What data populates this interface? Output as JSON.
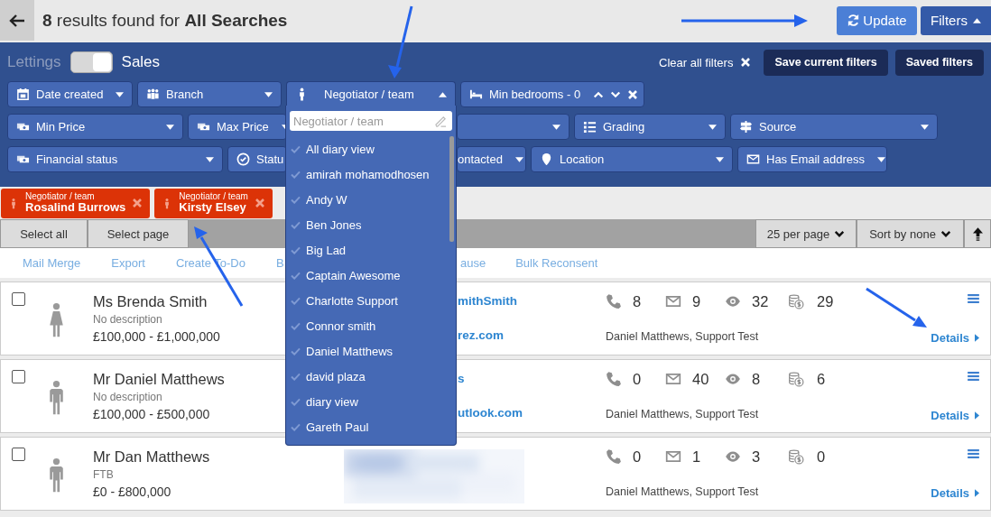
{
  "header": {
    "title": "**8** results found for **All Searches**",
    "update": {
      "label": "Update"
    },
    "filters": {
      "label": "Filters",
      "expanded": true
    }
  },
  "filter_panel": {
    "toggle": {
      "left_label": "Lettings",
      "right_label": "Sales",
      "on": true
    },
    "clear_label": "Clear all filters",
    "buttons": [
      "Save current filters",
      "Saved filters"
    ],
    "rows": [
      [
        {
          "kind": "select",
          "label": "Date created",
          "expanded": false
        },
        {
          "kind": "select",
          "label": "Branch",
          "expanded": false
        },
        {
          "kind": "select",
          "label": "Negotiator / team",
          "expanded": true
        },
        {
          "kind": "stepper",
          "label": "Min bedrooms - 0"
        }
      ],
      [
        {
          "kind": "select",
          "label": "Min Price",
          "expanded": false
        },
        {
          "kind": "select",
          "label": "Max Price",
          "expanded": false
        },
        {
          "kind": "fragment"
        },
        {
          "kind": "select",
          "label": "Grading",
          "expanded": false
        },
        {
          "kind": "select",
          "label": "Source",
          "expanded": false
        }
      ],
      [
        {
          "kind": "select",
          "label": "Financial status",
          "expanded": false
        },
        {
          "kind": "select",
          "label": "Statu",
          "expanded": false
        },
        {
          "kind": "fragment",
          "label": "ontacted"
        },
        {
          "kind": "select",
          "label": "Location",
          "expanded": false
        },
        {
          "kind": "select",
          "label": "Has Email address",
          "expanded": false
        }
      ]
    ]
  },
  "dropdown": {
    "placeholder": "Negotiator / team",
    "options": [
      {
        "label": "All diary view",
        "selected": false
      },
      {
        "label": "amirah mohamodhosen",
        "selected": false
      },
      {
        "label": "Andy W",
        "selected": false
      },
      {
        "label": "Ben Jones",
        "selected": false
      },
      {
        "label": "Big Lad",
        "selected": false
      },
      {
        "label": "Captain Awesome",
        "selected": false
      },
      {
        "label": "Charlotte Support",
        "selected": false
      },
      {
        "label": "Connor smith",
        "selected": false
      },
      {
        "label": "Daniel Matthews",
        "selected": false
      },
      {
        "label": "david plaza",
        "selected": false
      },
      {
        "label": "diary view",
        "selected": false
      },
      {
        "label": "Gareth Paul",
        "selected": false
      }
    ]
  },
  "active_filters": [
    {
      "caption": "Negotiator / team",
      "value": "Rosalind Burrows"
    },
    {
      "caption": "Negotiator / team",
      "value": "Kirsty Elsey"
    }
  ],
  "toolbar": {
    "select_buttons": [
      "Select all",
      "Select page"
    ],
    "per_page": "25 per page",
    "sort": "Sort by none"
  },
  "actions": {
    "left": [
      "Mail Merge",
      "Export",
      "Create To-Do",
      "B"
    ],
    "right": [
      "ause",
      "Bulk Reconsent"
    ]
  },
  "results": [
    {
      "name": "Ms Brenda Smith",
      "kind": "female",
      "description": "No description",
      "price": "£100,000 - £1,000,000",
      "checked": false,
      "contact": {
        "kind": "text",
        "lines": [
          "mithSmith",
          "rez.com"
        ]
      },
      "stats": [
        "8",
        "9",
        "32",
        "29"
      ],
      "negotiators": "Daniel Matthews, Support Test",
      "details": "Details"
    },
    {
      "name": "Mr Daniel Matthews",
      "kind": "male",
      "description": "No description",
      "price": "£100,000 - £500,000",
      "checked": false,
      "contact": {
        "kind": "text",
        "lines": [
          "s",
          "utlook.com"
        ]
      },
      "stats": [
        "0",
        "40",
        "8",
        "6"
      ],
      "negotiators": "Daniel Matthews, Support Test",
      "details": "Details"
    },
    {
      "name": "Mr Dan Matthews",
      "kind": "male",
      "description": "FTB",
      "price": "£0 - £800,000",
      "checked": false,
      "contact": {
        "kind": "picture"
      },
      "stats": [
        "0",
        "1",
        "3",
        "0"
      ],
      "negotiators": "Daniel Matthews, Support Test",
      "details": "Details"
    }
  ]
}
